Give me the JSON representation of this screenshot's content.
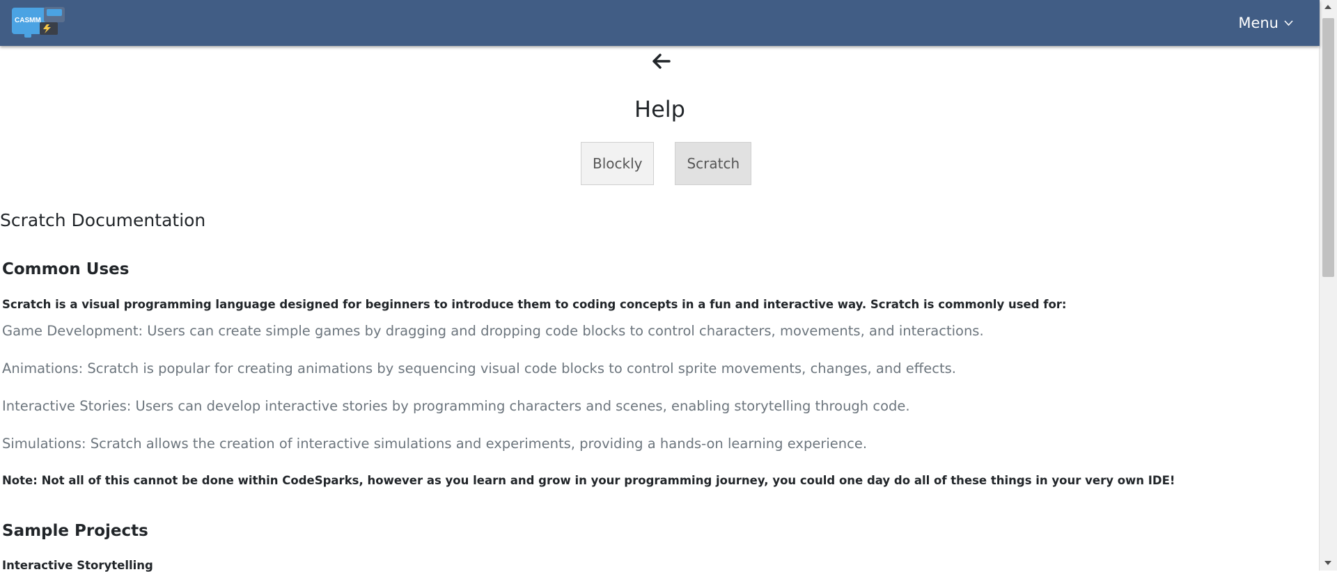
{
  "header": {
    "logo_text": "CASMM",
    "menu_label": "Menu"
  },
  "page": {
    "title": "Help",
    "tabs": [
      {
        "label": "Blockly",
        "active": false
      },
      {
        "label": "Scratch",
        "active": true
      }
    ]
  },
  "doc": {
    "title": "Scratch Documentation",
    "common_uses": {
      "heading": "Common Uses",
      "intro": "Scratch is a visual programming language designed for beginners to introduce them to coding concepts in a fun and interactive way. Scratch is commonly used for:",
      "items": [
        "Game Development: Users can create simple games by dragging and dropping code blocks to control characters, movements, and interactions.",
        "Animations: Scratch is popular for creating animations by sequencing visual code blocks to control sprite movements, changes, and effects.",
        "Interactive Stories: Users can develop interactive stories by programming characters and scenes, enabling storytelling through code.",
        "Simulations: Scratch allows the creation of interactive simulations and experiments, providing a hands-on learning experience."
      ],
      "note": "Note: Not all of this cannot be done within CodeSparks, however as you learn and grow in your programming journey, you could one day do all of these things in your very own IDE!"
    },
    "sample_projects": {
      "heading": "Sample Projects",
      "first_item": "Interactive Storytelling"
    }
  },
  "colors": {
    "navbar": "#415d85",
    "logo_blue": "#4ba3e3",
    "text": "#212529",
    "muted": "#6c757d"
  }
}
